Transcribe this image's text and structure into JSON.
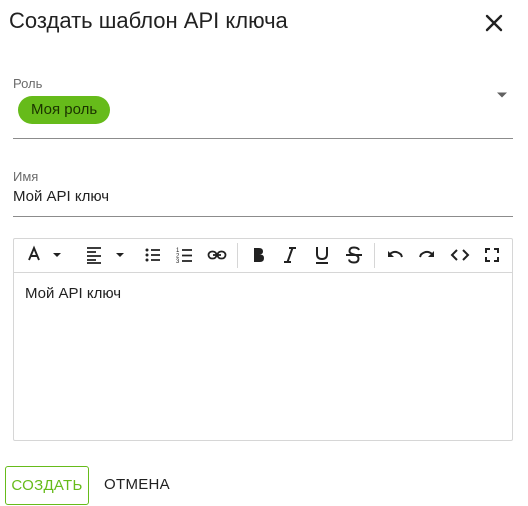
{
  "dialog": {
    "title": "Создать шаблон API ключа"
  },
  "role": {
    "label": "Роль",
    "chip": "Моя роль"
  },
  "name": {
    "label": "Имя",
    "value": "Мой API ключ"
  },
  "editor": {
    "content": "Мой API ключ",
    "toolbar_icons": [
      "font-color-icon",
      "align-left-icon",
      "bulleted-list-icon",
      "numbered-list-icon",
      "link-icon",
      "bold-icon",
      "italic-icon",
      "underline-icon",
      "strikethrough-icon",
      "undo-icon",
      "redo-icon",
      "code-icon",
      "fullscreen-icon"
    ]
  },
  "actions": {
    "create_label": "СОЗДАТЬ",
    "cancel_label": "ОТМЕНА"
  },
  "colors": {
    "accent": "#66bb1a",
    "text": "#212121",
    "border": "#d6d6d6"
  }
}
